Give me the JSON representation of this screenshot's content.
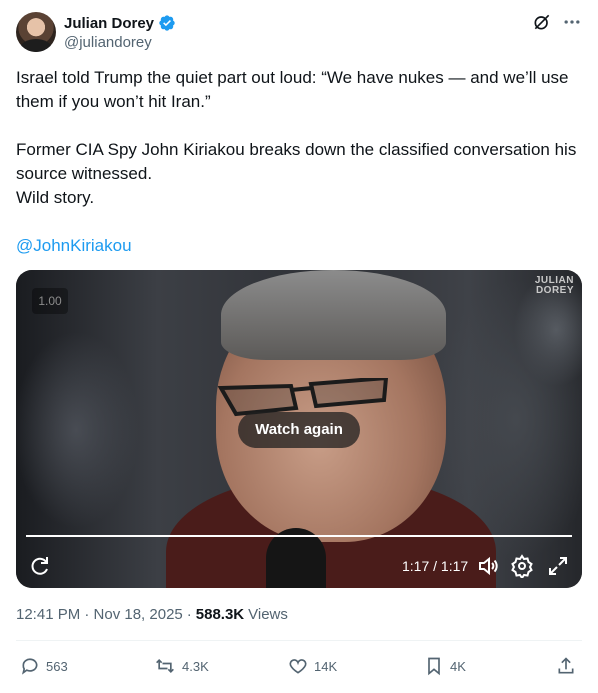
{
  "author": {
    "name": "Julian Dorey",
    "handle": "@juliandorey",
    "verified": true,
    "verified_color": "#1d9bf0"
  },
  "header_icons": [
    "grok-icon",
    "more-icon"
  ],
  "tweet": {
    "line1": "Israel told Trump the quiet part out loud: “We have nukes — and we’ll use them if you won’t hit Iran.”",
    "line2": "Former CIA Spy John Kiriakou breaks down the classified conversation his source witnessed.",
    "line3": "Wild story.",
    "mention": "@JohnKiriakou"
  },
  "video": {
    "playback_speed": "1.00",
    "watermark_line1": "JULIAN",
    "watermark_line2": "DOREY",
    "watch_again_label": "Watch again",
    "time": "1:17 / 1:17",
    "progress": 1.0,
    "controls": [
      "replay-icon",
      "volume-icon",
      "settings-icon",
      "fullscreen-icon"
    ]
  },
  "meta": {
    "timestamp": "12:41 PM · Nov 18, 2025",
    "separator": "·",
    "views_count": "588.3K",
    "views_label": "Views"
  },
  "actions": {
    "replies": "563",
    "reposts": "4.3K",
    "likes": "14K",
    "bookmarks": "4K"
  },
  "colors": {
    "text": "#0f1419",
    "secondary": "#536471",
    "accent": "#1d9bf0"
  }
}
